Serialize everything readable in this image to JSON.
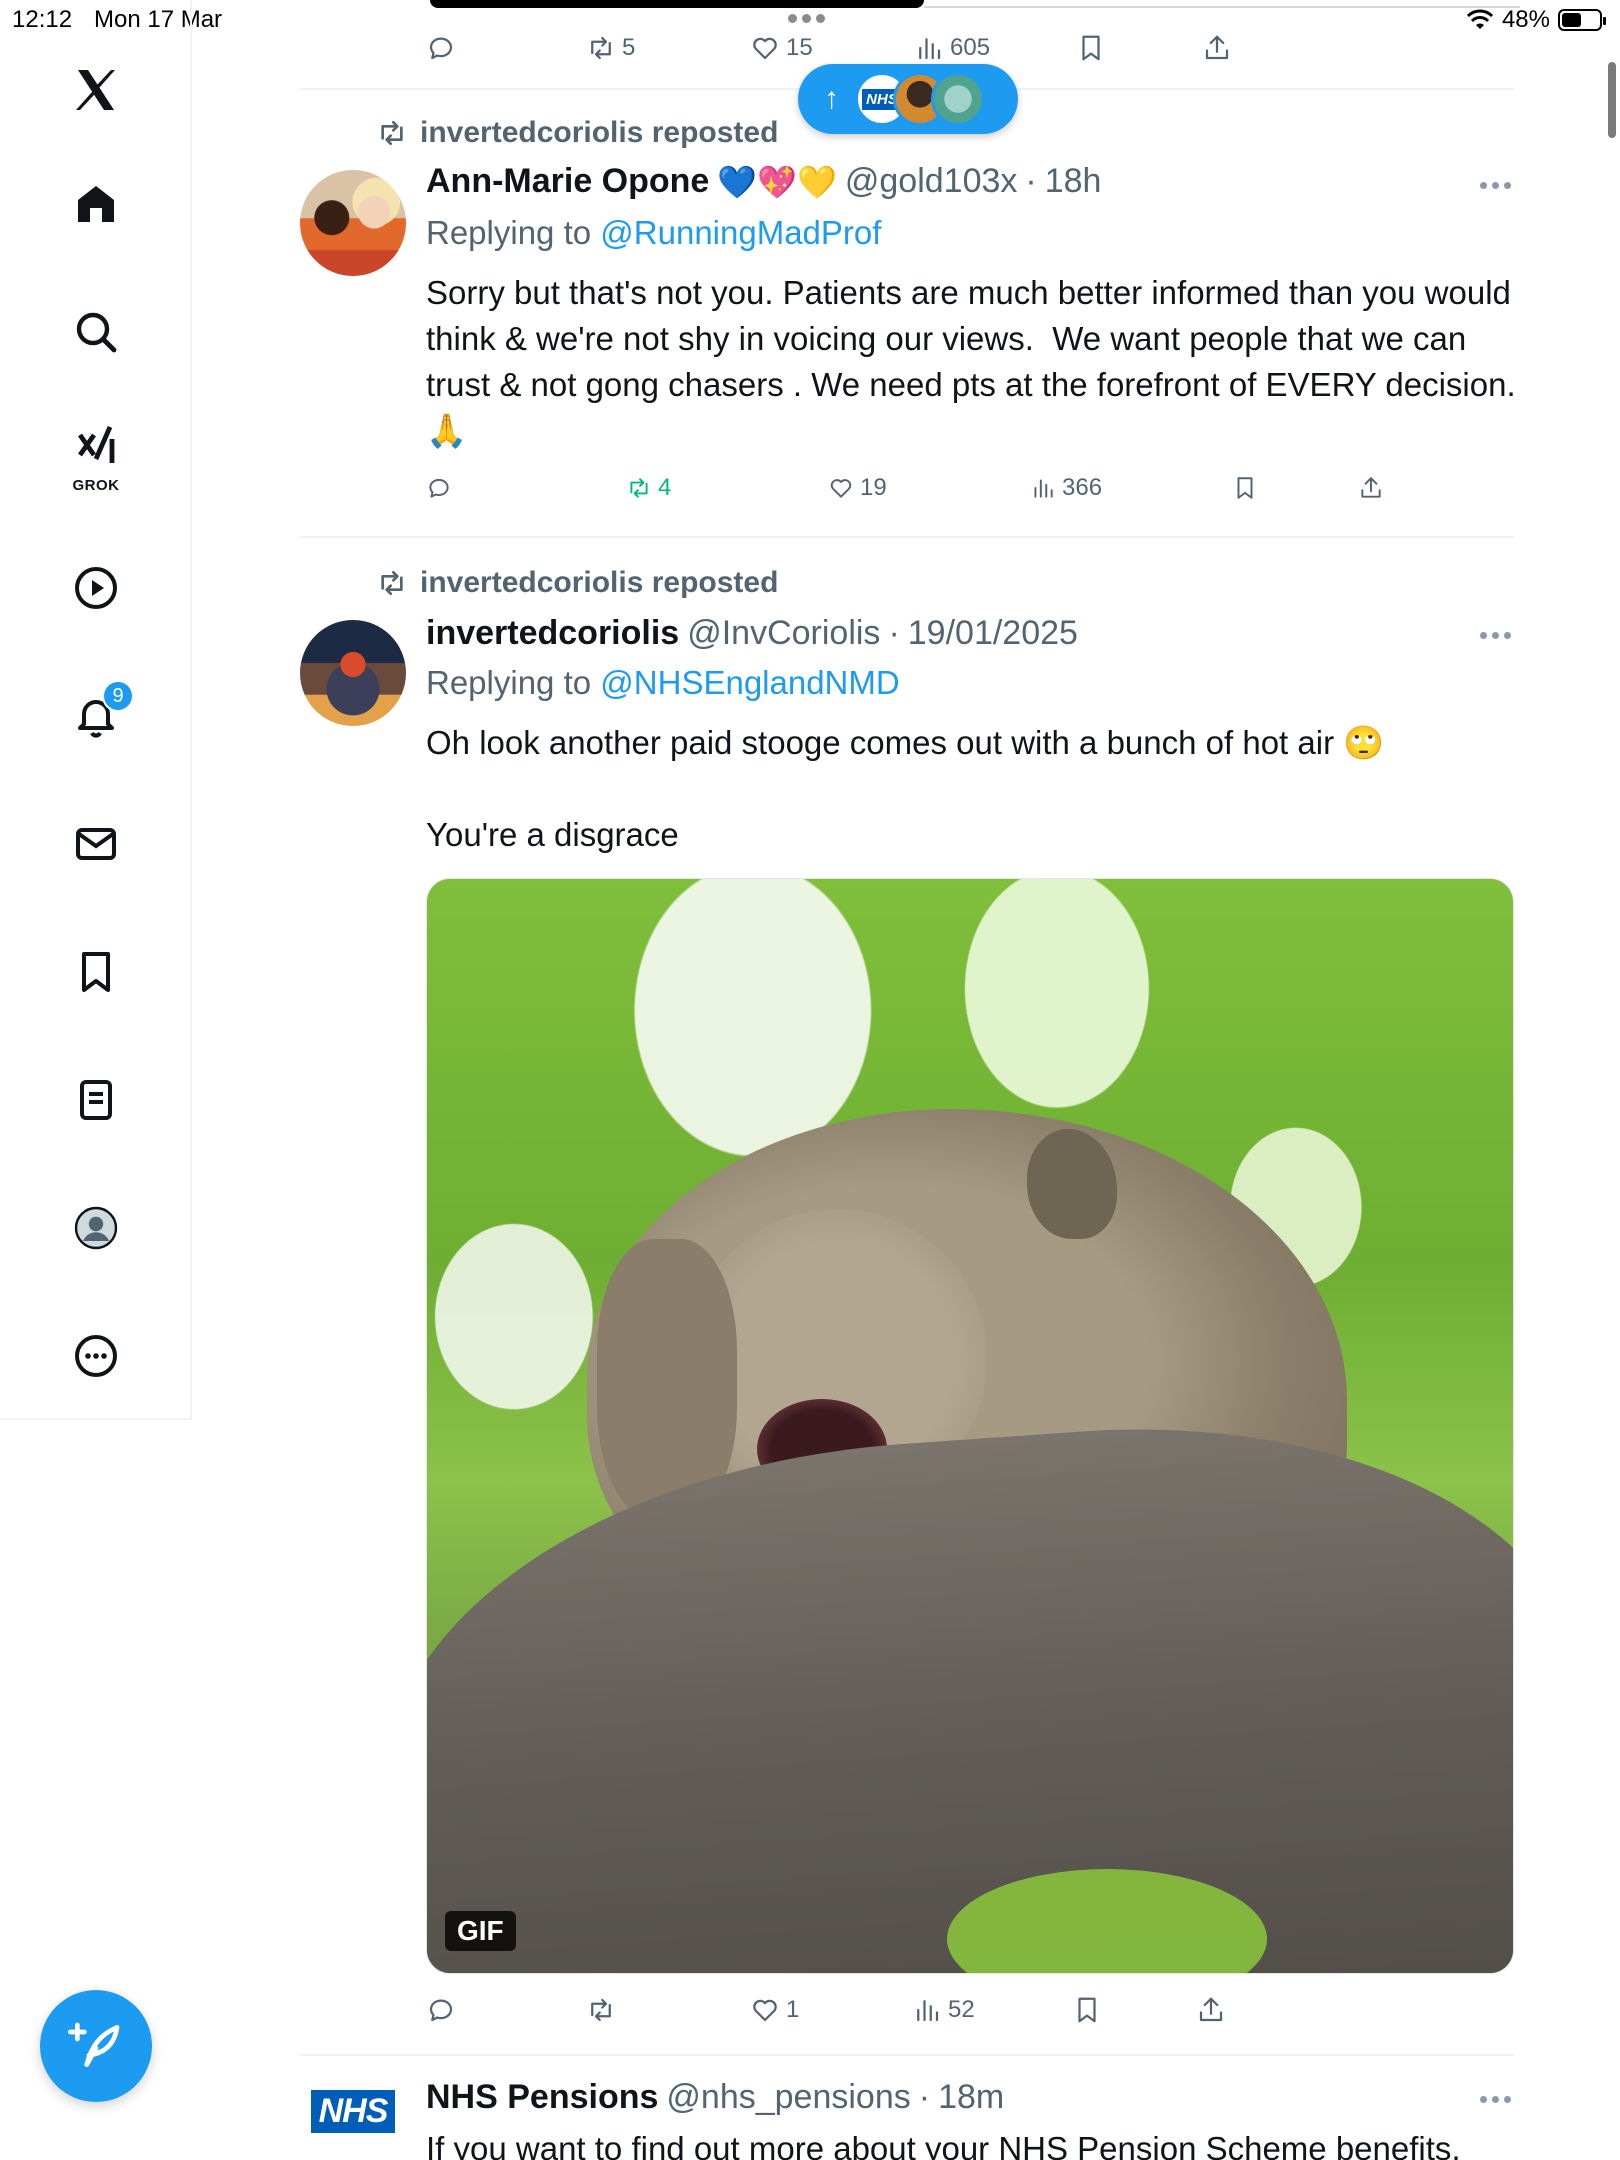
{
  "status_bar": {
    "time": "12:12",
    "date": "Mon 17 Mar",
    "battery": "48%"
  },
  "sidebar": {
    "items": [
      {
        "icon": "x-logo-icon"
      },
      {
        "icon": "home-icon"
      },
      {
        "icon": "search-icon"
      },
      {
        "icon": "grok-icon",
        "label": "GROK"
      },
      {
        "icon": "play-icon"
      },
      {
        "icon": "bell-icon",
        "badge": "9"
      },
      {
        "icon": "mail-icon"
      },
      {
        "icon": "bookmark-icon"
      },
      {
        "icon": "list-icon"
      },
      {
        "icon": "profile-icon"
      },
      {
        "icon": "more-icon"
      }
    ],
    "compose_icon": "compose-plus-icon"
  },
  "new_posts_pill": {
    "icon": "arrow-up-icon",
    "arrow": "↑",
    "nhs_logo": "NHS"
  },
  "top_post_actions": {
    "retweets": "5",
    "likes": "15",
    "views": "605"
  },
  "posts": [
    {
      "repost_by": "invertedcoriolis reposted",
      "name": "Ann-Marie Opone",
      "name_emojis": "💙💖💛",
      "handle": "@gold103x",
      "sep": "·",
      "time": "18h",
      "replying_label": "Replying to",
      "replying_to": "@RunningMadProf",
      "text": "Sorry but that's not you. Patients are much better informed than you would think & we're not shy in voicing our views.  We want people that we can trust & not gong chasers . We need pts at the forefront of EVERY decision.  🙏",
      "retweets": "4",
      "likes": "19",
      "views": "366"
    },
    {
      "repost_by": "invertedcoriolis reposted",
      "name": "invertedcoriolis",
      "handle": "@InvCoriolis",
      "sep": "·",
      "time": "19/01/2025",
      "replying_label": "Replying to",
      "replying_to": "@NHSEnglandNMD",
      "text": "Oh look another paid stooge comes out with a bunch of hot air 🙄\n\nYou're a disgrace",
      "media_badge": "GIF",
      "likes": "1",
      "views": "52"
    },
    {
      "name": "NHS Pensions",
      "handle": "@nhs_pensions",
      "sep": "·",
      "time": "18m",
      "avatar_logo": "NHS",
      "text": "If you want to find out more about your NHS Pension Scheme benefits,"
    }
  ],
  "colors": {
    "accent": "#1d9bf0",
    "retweet_active": "#00ba7c",
    "muted": "#536471"
  }
}
